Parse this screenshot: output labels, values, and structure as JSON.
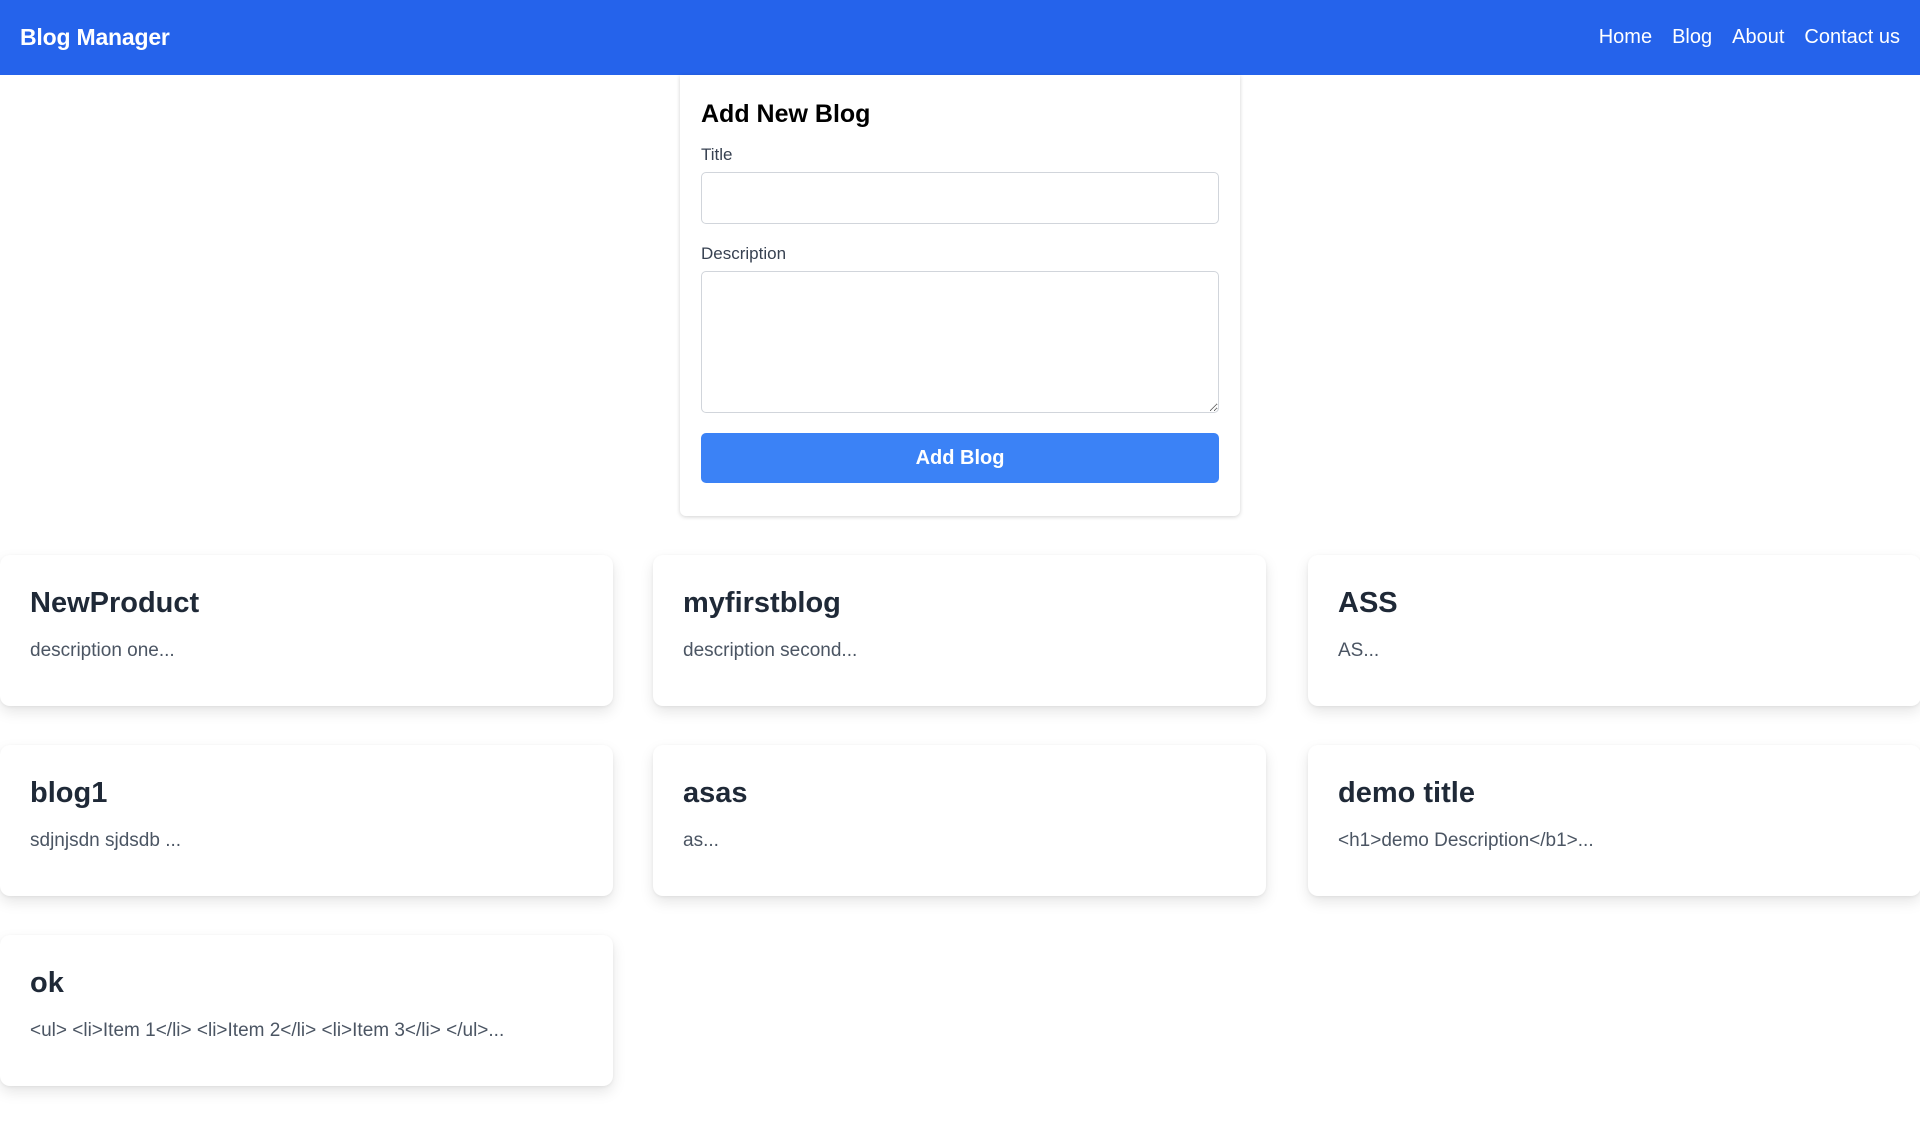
{
  "navbar": {
    "brand": "Blog Manager",
    "links": [
      "Home",
      "Blog",
      "About",
      "Contact us"
    ]
  },
  "form": {
    "heading": "Add New Blog",
    "title_label": "Title",
    "title_value": "",
    "description_label": "Description",
    "description_value": "",
    "submit_label": "Add Blog"
  },
  "blogs": [
    {
      "title": "NewProduct",
      "description": "description one..."
    },
    {
      "title": "myfirstblog",
      "description": "description second..."
    },
    {
      "title": "ASS",
      "description": "AS..."
    },
    {
      "title": "blog1",
      "description": "sdjnjsdn sjdsdb ..."
    },
    {
      "title": "asas",
      "description": "as..."
    },
    {
      "title": "demo title",
      "description": "<h1>demo Description</b1>..."
    },
    {
      "title": "ok",
      "description": "<ul> <li>Item 1</li> <li>Item 2</li> <li>Item 3</li> </ul>..."
    }
  ],
  "colors": {
    "navbar_bg": "#2563eb",
    "button_bg": "#3b82f6"
  }
}
